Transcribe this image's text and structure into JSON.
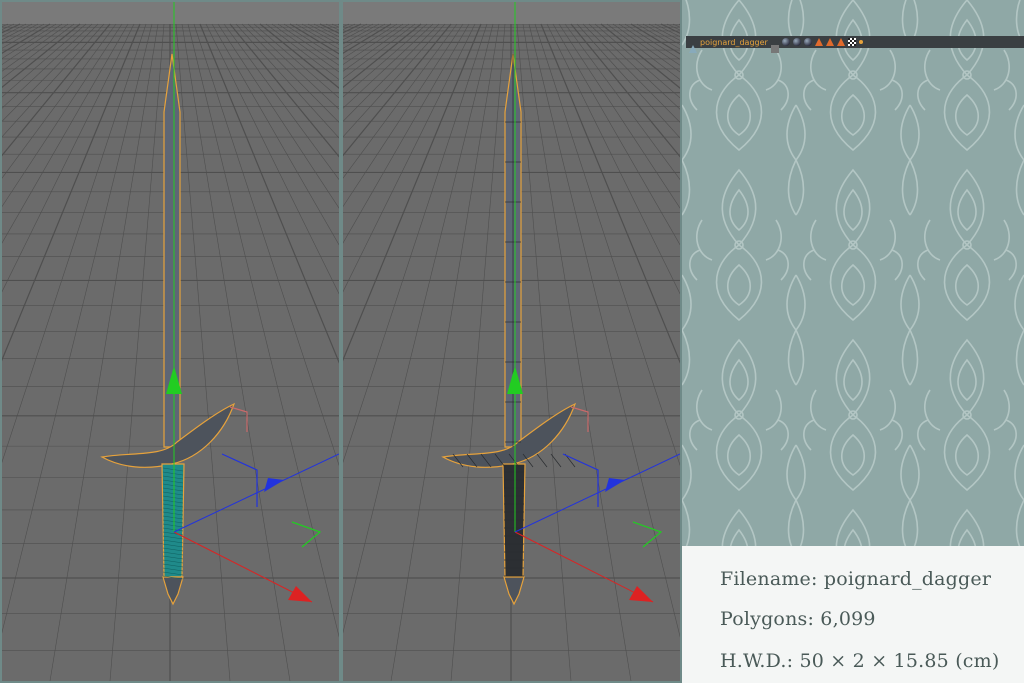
{
  "viewports": [
    {
      "id": "shaded",
      "mode": "shaded"
    },
    {
      "id": "wireframe",
      "mode": "shaded-wireframe"
    }
  ],
  "toolbar": {
    "object_name": "poignard_dagger",
    "icons": [
      "object-icon",
      "display-toggle-icon",
      "material-ball-icon",
      "triangle-tag-icon",
      "checker-tag-icon",
      "dot-icon"
    ]
  },
  "info": {
    "filename": "Filename: poignard_dagger",
    "polygons": "Polygons: 6,099",
    "dimensions": "H.W.D.: 50 × 2 × 15.85 (cm)"
  },
  "colors": {
    "viewport_bg": "#6b6b6b",
    "grid": "#4f4f4f",
    "blade": "#5e6675",
    "grip": "#1f8a8a",
    "outline": "#e6a23c",
    "axis_y": "#22cc22",
    "axis_x": "#dd2222",
    "axis_z": "#2233dd",
    "panel_bg": "#8fa8a6",
    "info_bg": "#f4f6f5",
    "info_text": "#4a5a58"
  }
}
